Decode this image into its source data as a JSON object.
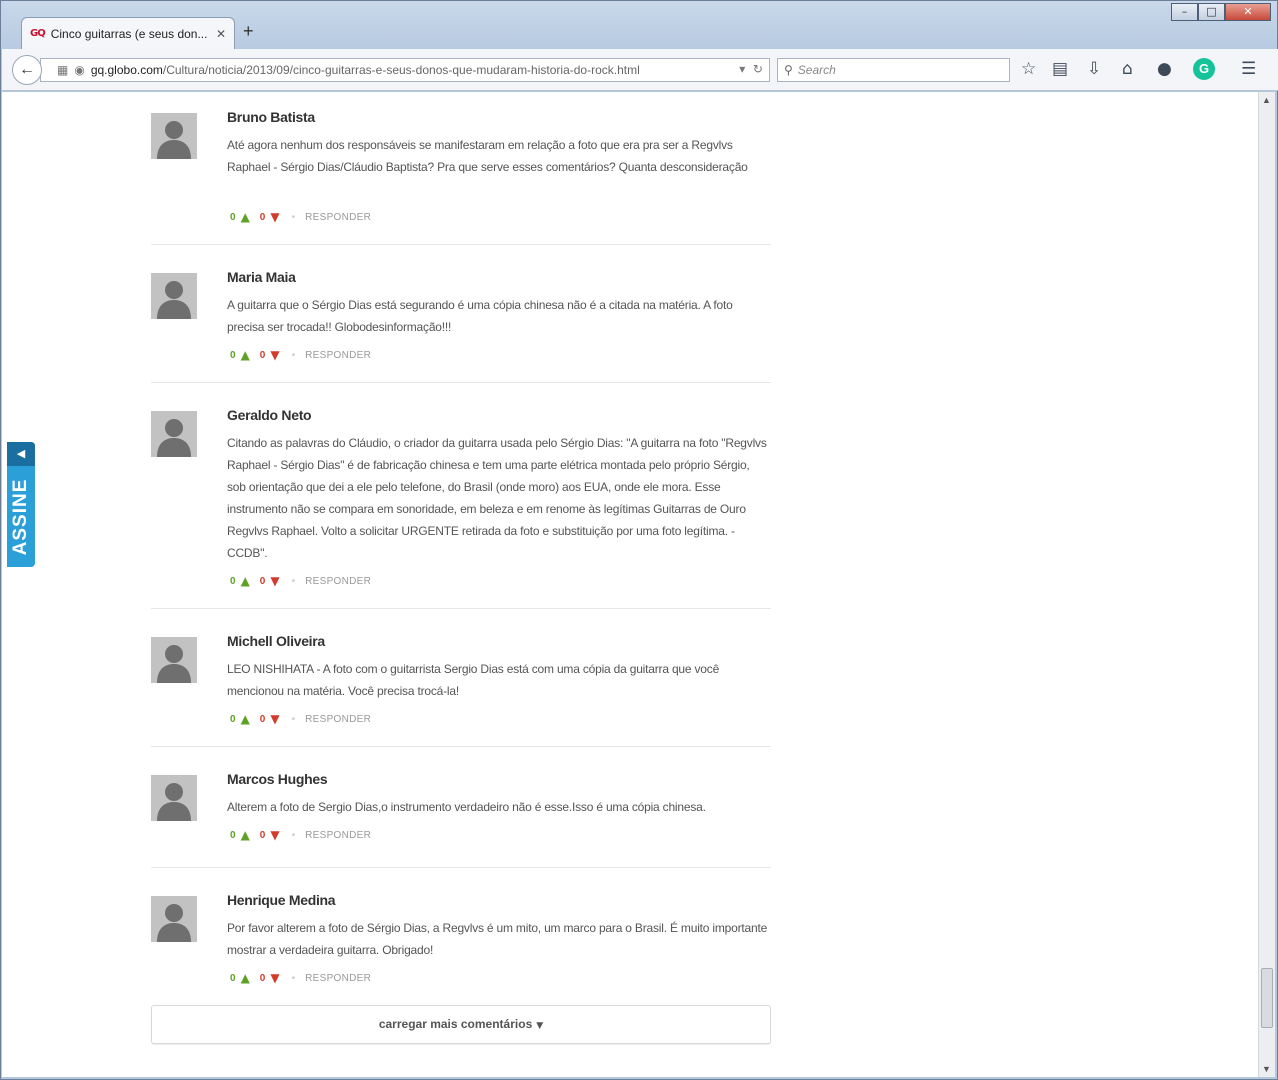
{
  "browser": {
    "tab_title": "Cinco guitarras (e seus don...",
    "tab_logo": "GQ",
    "new_tab_label": "+",
    "url_host": "gq.globo.com",
    "url_path": "/Cultura/noticia/2013/09/cinco-guitarras-e-seus-donos-que-mudaram-historia-do-rock.html",
    "search_placeholder": "Search",
    "icons": [
      "back-arrow-icon",
      "reader-icon",
      "globe-icon",
      "reload-icon",
      "search-icon",
      "star-icon",
      "bookmarks-icon",
      "download-icon",
      "home-icon",
      "extension-icon",
      "grammarly-icon",
      "menu-icon"
    ]
  },
  "side_tab": {
    "label": "ASSINE",
    "color": "#2a9fd8"
  },
  "comments": [
    {
      "author": "Bruno Batista",
      "text": "Até agora nenhum dos responsáveis se manifestaram em relação a foto que era pra ser a Regvlvs Raphael - Sérgio Dias/Cláudio Baptista? Pra que serve esses comentários? Quanta desconsideração",
      "likes": "0",
      "dislikes": "0",
      "reply": "RESPONDER"
    },
    {
      "author": "Maria Maia",
      "text": "A guitarra que o Sérgio Dias está segurando é uma cópia chinesa não é a citada na matéria. A foto precisa ser trocada!! Globodesinformação!!!",
      "likes": "0",
      "dislikes": "0",
      "reply": "RESPONDER"
    },
    {
      "author": "Geraldo Neto",
      "text": "Citando as palavras do Cláudio, o criador da guitarra usada pelo Sérgio Dias: \"A guitarra na foto \"Regvlvs Raphael - Sérgio Dias\" é de fabricação chinesa e tem uma parte elétrica montada pelo próprio Sérgio, sob orientação que dei a ele pelo telefone, do Brasil (onde moro) aos EUA, onde ele mora. Esse instrumento não se compara em sonoridade, em beleza e em renome às legítimas Guitarras de Ouro Regvlvs Raphael. Volto a solicitar URGENTE retirada da foto e substituição por uma foto legítima. - CCDB\".",
      "likes": "0",
      "dislikes": "0",
      "reply": "RESPONDER"
    },
    {
      "author": "Michell Oliveira",
      "text": "LEO NISHIHATA - A foto com o guitarrista Sergio Dias está com uma cópia da guitarra que você mencionou na matéria. Você precisa trocá-la!",
      "likes": "0",
      "dislikes": "0",
      "reply": "RESPONDER"
    },
    {
      "author": "Marcos Hughes",
      "text": "Alterem a foto de Sergio Dias,o instrumento verdadeiro não é esse.Isso é uma cópia chinesa.",
      "likes": "0",
      "dislikes": "0",
      "reply": "RESPONDER"
    },
    {
      "author": "Henrique Medina",
      "text": "Por favor alterem a foto de Sérgio Dias, a Regvlvs é um mito, um marco para o Brasil. É muito importante mostrar a verdadeira guitarra. Obrigado!",
      "likes": "0",
      "dislikes": "0",
      "reply": "RESPONDER"
    }
  ],
  "load_more_label": "carregar mais comentários",
  "colors": {
    "like": "#5da125",
    "dislike": "#d23b2b"
  }
}
